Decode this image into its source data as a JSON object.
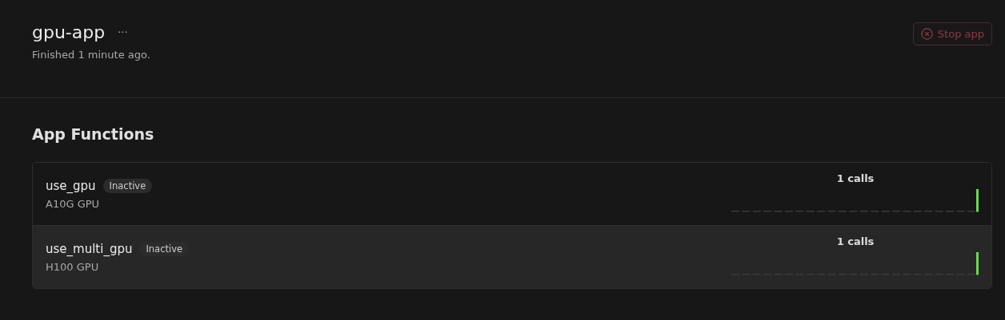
{
  "app": {
    "title": "gpu-app",
    "menu_glyph": "···",
    "status": "Finished 1 minute ago.",
    "stop_button": "Stop app"
  },
  "section_title": "App Functions",
  "functions": [
    {
      "name": "use_gpu",
      "badge": "Inactive",
      "gpu": "A10G GPU",
      "calls": "1 calls",
      "selected": false
    },
    {
      "name": "use_multi_gpu",
      "badge": "Inactive",
      "gpu": "H100 GPU",
      "calls": "1 calls",
      "selected": true
    }
  ]
}
